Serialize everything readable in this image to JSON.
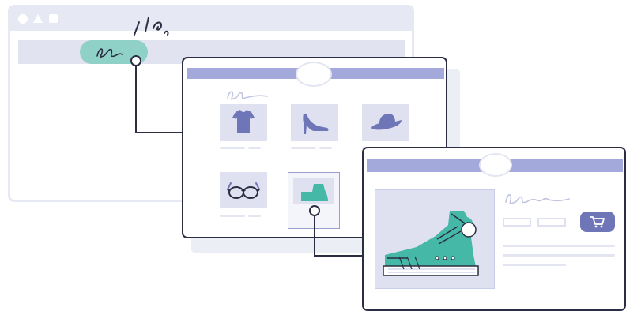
{
  "colors": {
    "window_outline": "#2b2d42",
    "header_bar": "#a3a9db",
    "tile_fill": "#dfe1f0",
    "selection_highlight": "#8fd1c6",
    "product_accent": "#45b8a8",
    "cart_button": "#6f76b8"
  },
  "catalog": {
    "products": [
      {
        "icon": "t-shirt-icon"
      },
      {
        "icon": "high-heel-icon"
      },
      {
        "icon": "sun-hat-icon"
      },
      {
        "icon": "sunglasses-icon"
      },
      {
        "icon": "sneaker-icon",
        "selected": true
      }
    ]
  },
  "product_page": {
    "image_icon": "sneaker-icon",
    "action_icon": "shopping-cart-icon"
  },
  "back_window": {
    "controls": [
      "circle-control-icon",
      "triangle-control-icon",
      "square-control-icon"
    ]
  }
}
